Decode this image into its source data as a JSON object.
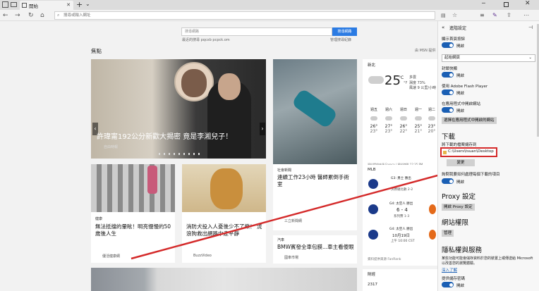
{
  "browser": {
    "tab_title": "開始",
    "new_tab_symbol": "+",
    "tab_menu_symbol": "⌄",
    "address_placeholder": "搜尋或輸入網址"
  },
  "search": {
    "placeholder": "搜尋網路",
    "button": "搜尋網路",
    "trending": "最近的搜尋   pqcxb   pcpck.om",
    "right_link": "管理搜尋紀錄"
  },
  "feed": {
    "title": "焦點",
    "msn_link": "由 MSN 提供",
    "hero": {
      "title": "許瑋甯192公分新歡大揭密 竟是李湘兒子！",
      "source": "自由時報"
    },
    "card_hospital": {
      "category": "社會新聞",
      "title": "連續工作23小時 醫師累倒手術室",
      "source": "三立新聞網"
    },
    "card_crosswalk": {
      "category": "健康",
      "title": "無法抵擋的暈眩！明亮慢慢的50歲後人生",
      "source": "優活健康網"
    },
    "card_dog": {
      "title": "消防犬投入人憂後少不了樂！ 流浪狗救出網路中走平靜",
      "source": "BuzzVideo"
    },
    "card_bmw": {
      "category": "汽車",
      "title": "BMW賓發全車包膜...車主看傻眼",
      "source": "國車市場"
    }
  },
  "weather": {
    "city": "新北",
    "temp": "25",
    "unit": "°C",
    "scale_toggle": "°F",
    "desc": "多雲",
    "details": "濕度 73%\n風速 9 公里/小時",
    "days": [
      {
        "name": "週五",
        "hi": "26°",
        "lo": "23°"
      },
      {
        "name": "週六",
        "hi": "27°",
        "lo": "23°"
      },
      {
        "name": "週日",
        "hi": "26°",
        "lo": "22°"
      },
      {
        "name": "週一",
        "hi": "25°",
        "lo": "21°"
      },
      {
        "name": "週二",
        "hi": "23°",
        "lo": "20°"
      }
    ],
    "footer": "資料提供來源 Foreca | 資料時間 12:35 PM"
  },
  "mlb": {
    "title": "MLB",
    "games": [
      {
        "label": "G3: 勇士 勝出",
        "score": "",
        "sub": "決賽總比數 2-2"
      },
      {
        "label": "G4: 太空人 勝出",
        "score": "6 - 4",
        "sub": "系列賽 1-3"
      },
      {
        "label": "G4: 太空人 勝出",
        "score": "10月19日",
        "sub": "上午 10:00 CST"
      }
    ],
    "footer": "資料提供來源 FanRank"
  },
  "finance": {
    "title": "財經",
    "value": "2317"
  },
  "settings": {
    "back_symbol": "«",
    "title": "進階設定",
    "pin_symbol": "⊣",
    "home_button_label": "顯示首頁按鈕",
    "toggle_on": "開啟",
    "home_page_select": "起始網頁",
    "popup_label": "封鎖快顯",
    "flash_label": "使用 Adobe Flash Player",
    "open_in_app_label": "在應用程式中開啟網站",
    "choose_apps_button": "選擇在應用程式中開啟的網站",
    "download_heading": "下載",
    "save_location_label": "將下載的檔案儲存到",
    "download_path": "C:\\Users\\tsuan\\Desktop",
    "change_button": "變更",
    "ask_download_label": "詢問我要如何處理每個下載的項目",
    "proxy_heading": "Proxy 設定",
    "proxy_button": "開啟 Proxy 設定",
    "permissions_heading": "網站權限",
    "manage_button": "管理",
    "privacy_heading": "隱私權與服務",
    "privacy_text": "某些功能可能會儲存資料於您的裝置上或傳送給 Microsoft 以改善您的瀏覽體驗。",
    "learn_more": "深入了解",
    "save_password_label": "提供儲存密碼"
  }
}
